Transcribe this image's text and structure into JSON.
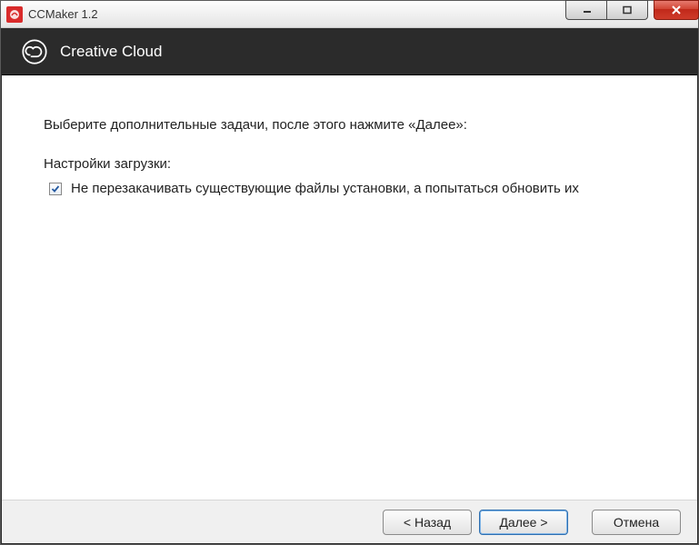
{
  "window": {
    "title": "CCMaker 1.2"
  },
  "banner": {
    "title": "Creative Cloud"
  },
  "content": {
    "instruction": "Выберите дополнительные задачи, после этого нажмите «Далее»:",
    "section_label": "Настройки загрузки:",
    "option1_label": "Не перезакачивать существующие файлы установки, а попытаться обновить их",
    "option1_checked": true
  },
  "footer": {
    "back": "< Назад",
    "next": "Далее >",
    "cancel": "Отмена"
  }
}
